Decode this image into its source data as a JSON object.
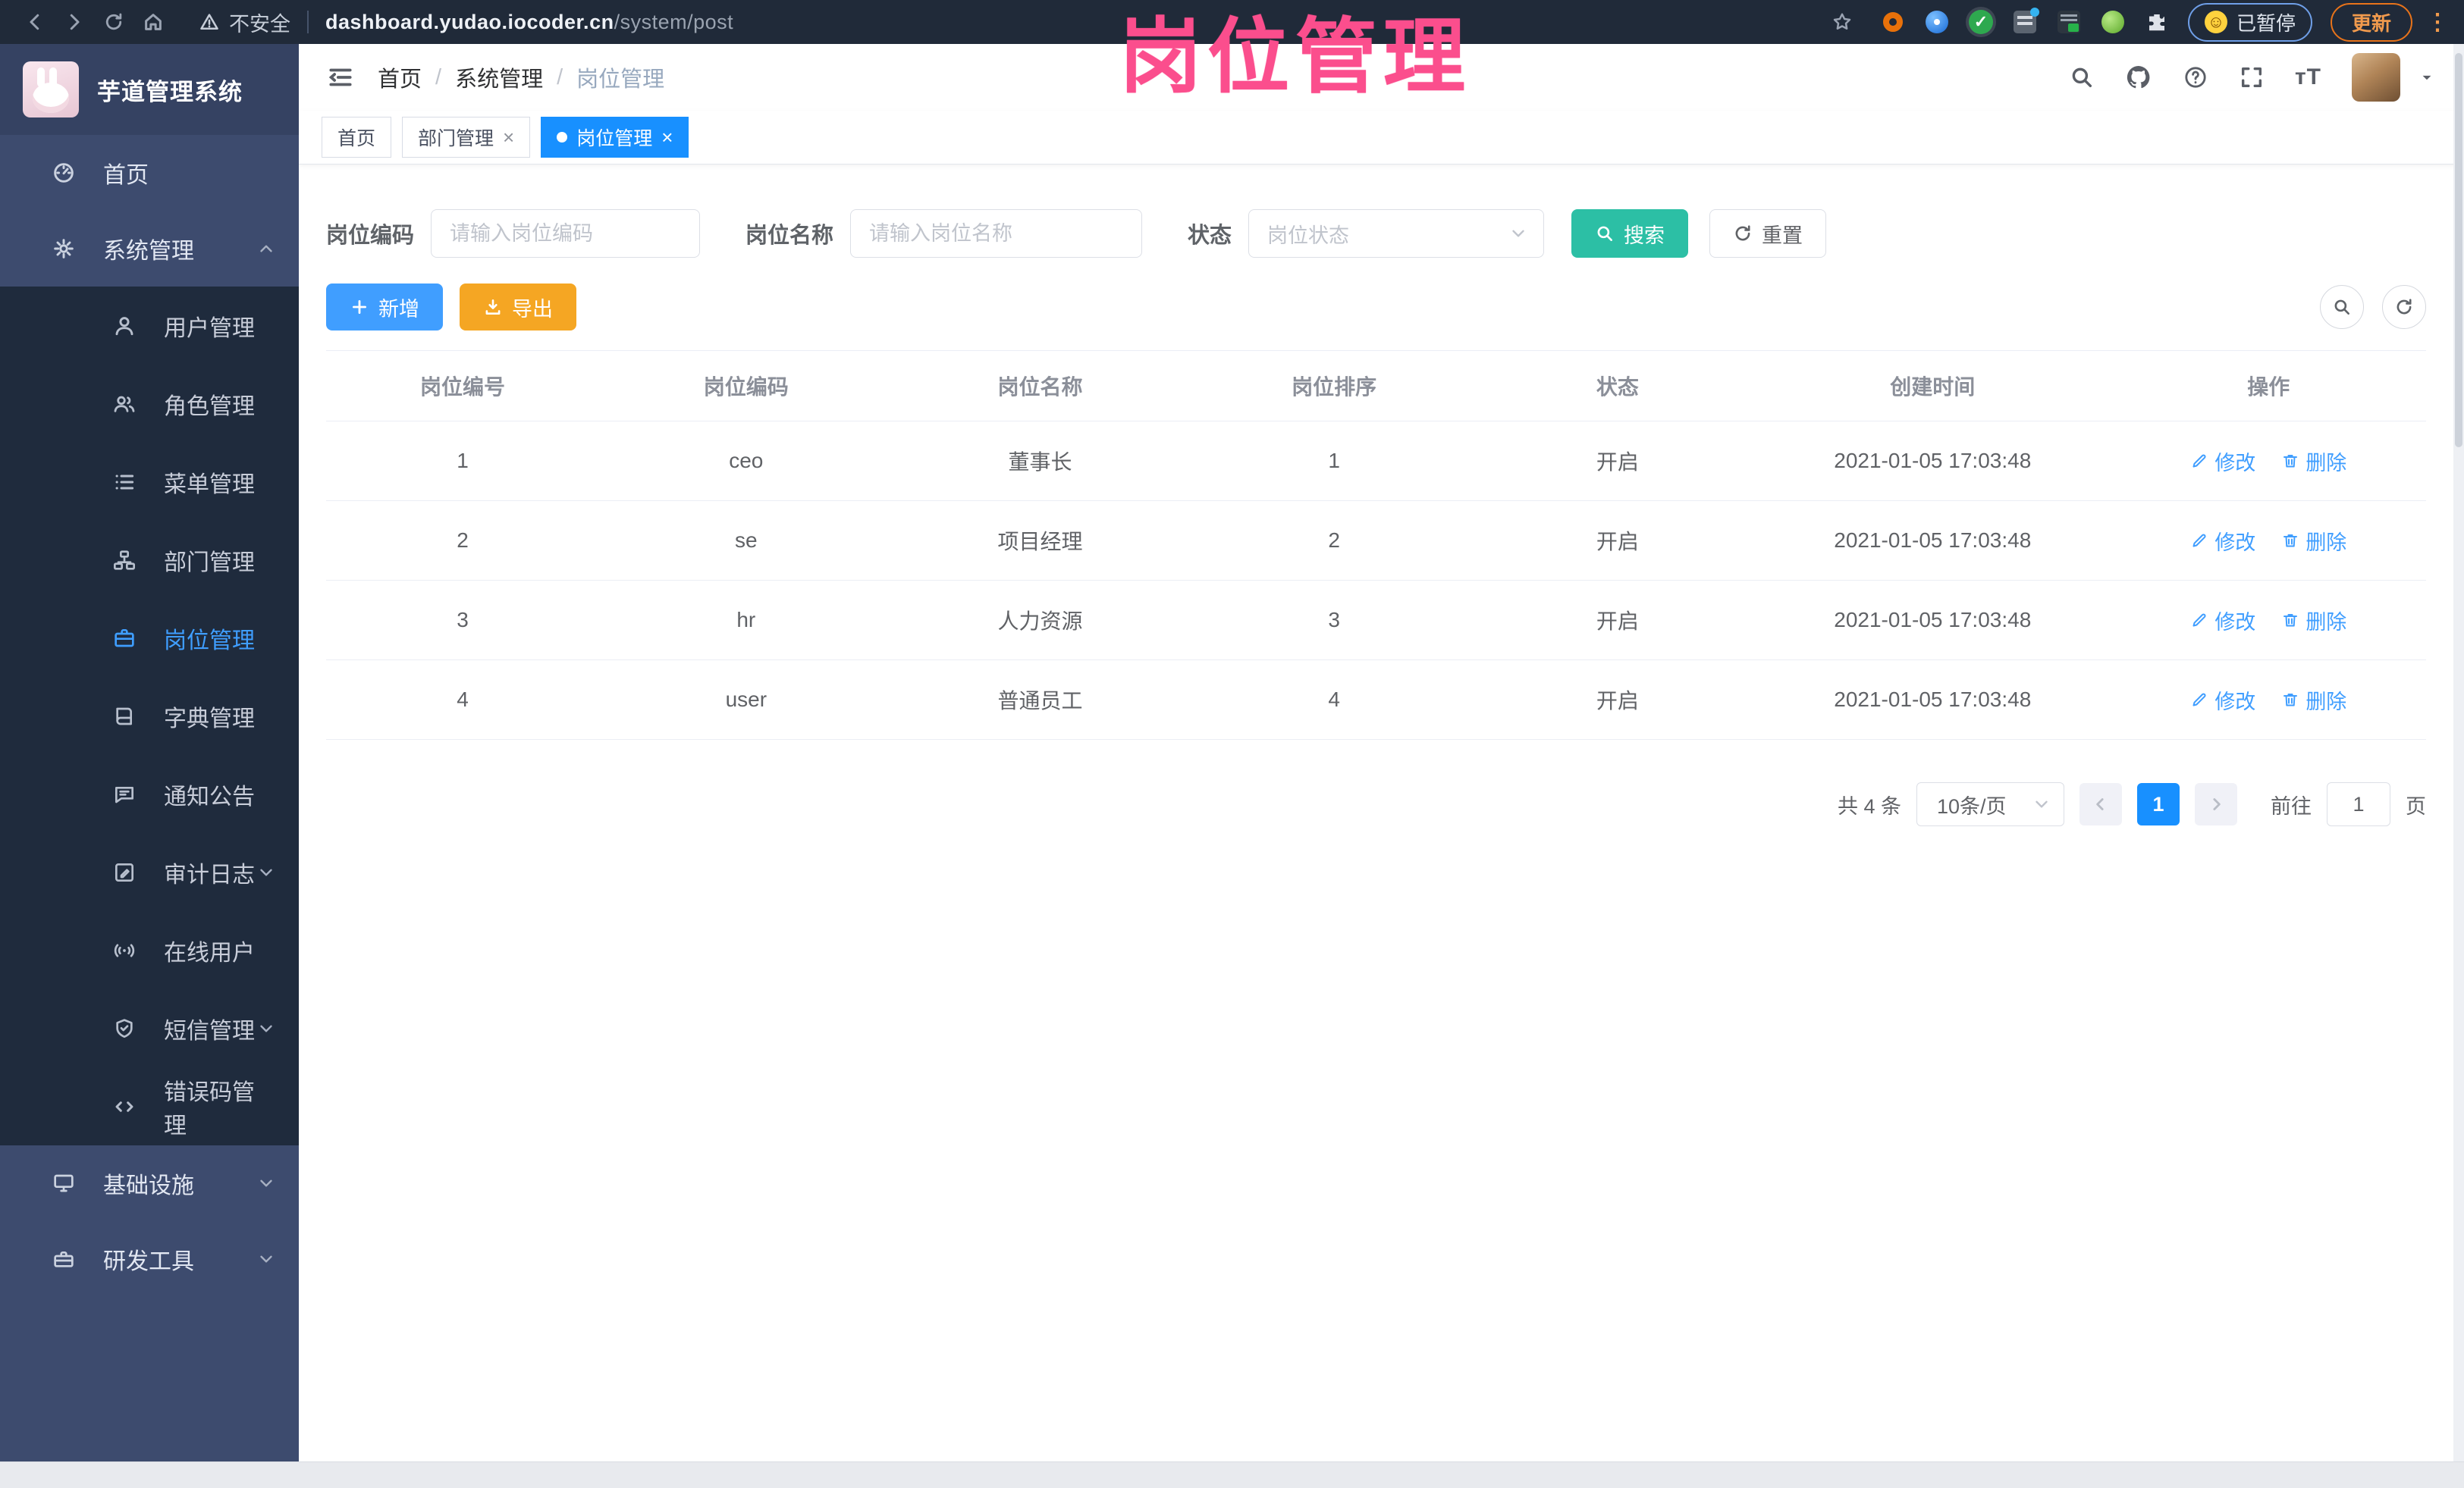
{
  "browser": {
    "security_label": "不安全",
    "url_domain": "dashboard.yudao.iocoder.cn",
    "url_path": "/system/post",
    "paused_chip_label": "已暂停",
    "update_button_label": "更新"
  },
  "overlay_title": "岗位管理",
  "sidebar": {
    "logo_title": "芋道管理系统",
    "home_label": "首页",
    "system_label": "系统管理",
    "sub_items": [
      "用户管理",
      "角色管理",
      "菜单管理",
      "部门管理",
      "岗位管理",
      "字典管理",
      "通知公告",
      "审计日志",
      "在线用户",
      "短信管理",
      "错误码管理"
    ],
    "infra_label": "基础设施",
    "devtools_label": "研发工具"
  },
  "breadcrumb": {
    "items": [
      "首页",
      "系统管理",
      "岗位管理"
    ]
  },
  "tabs": {
    "items": [
      {
        "label": "首页"
      },
      {
        "label": "部门管理"
      },
      {
        "label": "岗位管理"
      }
    ]
  },
  "filters": {
    "post_code_label": "岗位编码",
    "post_code_placeholder": "请输入岗位编码",
    "post_name_label": "岗位名称",
    "post_name_placeholder": "请输入岗位名称",
    "status_label": "状态",
    "status_placeholder": "岗位状态",
    "search_label": "搜索",
    "reset_label": "重置"
  },
  "toolbar": {
    "add_label": "新增",
    "export_label": "导出"
  },
  "table": {
    "columns": [
      "岗位编号",
      "岗位编码",
      "岗位名称",
      "岗位排序",
      "状态",
      "创建时间",
      "操作"
    ],
    "edit_label": "修改",
    "delete_label": "删除",
    "rows": [
      {
        "no": "1",
        "code": "ceo",
        "name": "董事长",
        "sort": "1",
        "status": "开启",
        "created": "2021-01-05 17:03:48"
      },
      {
        "no": "2",
        "code": "se",
        "name": "项目经理",
        "sort": "2",
        "status": "开启",
        "created": "2021-01-05 17:03:48"
      },
      {
        "no": "3",
        "code": "hr",
        "name": "人力资源",
        "sort": "3",
        "status": "开启",
        "created": "2021-01-05 17:03:48"
      },
      {
        "no": "4",
        "code": "user",
        "name": "普通员工",
        "sort": "4",
        "status": "开启",
        "created": "2021-01-05 17:03:48"
      }
    ]
  },
  "pagination": {
    "total_label": "共 4 条",
    "page_size_label": "10条/页",
    "active_page": "1",
    "goto_prefix": "前往",
    "goto_value": "1",
    "goto_suffix": "页"
  },
  "colors": {
    "primary_blue": "#409eff",
    "tab_active_blue": "#1890ff",
    "search_teal": "#2cbfa5",
    "export_orange": "#f5a623",
    "sidebar_bg": "#3d4b6e",
    "submenu_bg": "#1f2b3d",
    "overlay_pink": "#fb4e8d"
  }
}
